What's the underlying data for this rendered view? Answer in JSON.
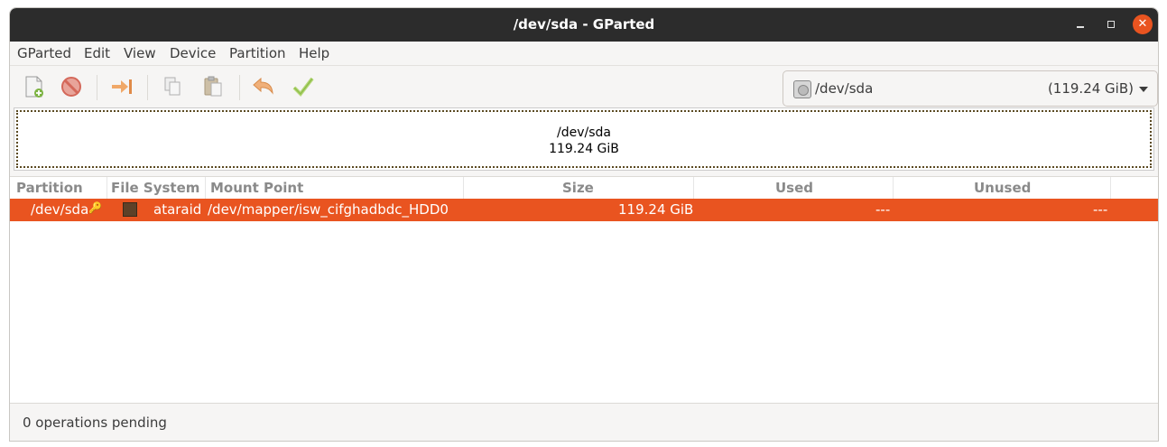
{
  "window": {
    "title": "/dev/sda - GParted"
  },
  "menubar": [
    "GParted",
    "Edit",
    "View",
    "Device",
    "Partition",
    "Help"
  ],
  "toolbar": {
    "buttons": [
      "new-icon",
      "delete-icon",
      "resize-move-icon",
      "copy-icon",
      "paste-icon",
      "undo-icon",
      "apply-icon"
    ]
  },
  "device_selector": {
    "name": "/dev/sda",
    "size": "(119.24 GiB)"
  },
  "disk_map": {
    "device": "/dev/sda",
    "size": "119.24 GiB"
  },
  "table": {
    "columns": [
      "Partition",
      "File System",
      "Mount Point",
      "Size",
      "Used",
      "Unused"
    ],
    "rows": [
      {
        "partition": "/dev/sda",
        "filesystem": "ataraid",
        "mount_point": "/dev/mapper/isw_cifghadbdc_HDD0",
        "size": "119.24 GiB",
        "used": "---",
        "unused": "---",
        "fs_color": "#5e4128",
        "selected": true
      }
    ]
  },
  "status": {
    "text": "0 operations pending"
  },
  "colors": {
    "accent": "#e95420",
    "titlebar": "#2c2c2c"
  }
}
